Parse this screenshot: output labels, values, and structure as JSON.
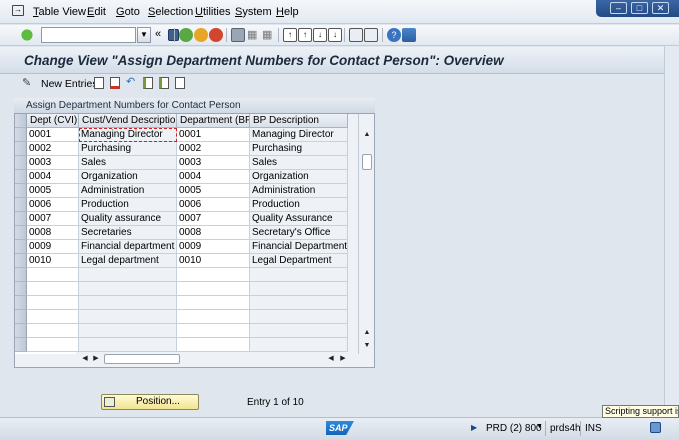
{
  "menu": {
    "items": [
      "Table View",
      "Edit",
      "Goto",
      "Selection",
      "Utilities",
      "System",
      "Help"
    ]
  },
  "toolbar": {
    "command_field_value": "",
    "icons": [
      "enter-icon",
      "save-icon",
      "back-icon",
      "exit-icon",
      "cancel-icon",
      "print-icon",
      "find-icon",
      "find-next-icon",
      "first-page-icon",
      "previous-page-icon",
      "next-page-icon",
      "last-page-icon",
      "create-session-icon",
      "shortcut-icon",
      "help-icon",
      "layout-icon"
    ]
  },
  "title": "Change View \"Assign Department Numbers for Contact Person\": Overview",
  "app_toolbar": {
    "new_entries_label": "New Entries",
    "icons": [
      "display-change-icon",
      "copy-icon",
      "delete-icon",
      "undo-icon",
      "select-all-icon",
      "select-block-icon",
      "deselect-all-icon"
    ]
  },
  "table": {
    "title": "Assign Department Numbers for Contact Person",
    "columns": [
      "Dept (CVI)",
      "Cust/Vend Description",
      "Department (BP)",
      "BP Description"
    ],
    "rows": [
      [
        "0001",
        "Managing Director",
        "0001",
        "Managing Director"
      ],
      [
        "0002",
        "Purchasing",
        "0002",
        "Purchasing"
      ],
      [
        "0003",
        "Sales",
        "0003",
        "Sales"
      ],
      [
        "0004",
        "Organization",
        "0004",
        "Organization"
      ],
      [
        "0005",
        "Administration",
        "0005",
        "Administration"
      ],
      [
        "0006",
        "Production",
        "0006",
        "Production"
      ],
      [
        "0007",
        "Quality assurance",
        "0007",
        "Quality Assurance"
      ],
      [
        "0008",
        "Secretaries",
        "0008",
        "Secretary's Office"
      ],
      [
        "0009",
        "Financial department",
        "0009",
        "Financial Department"
      ],
      [
        "0010",
        "Legal department",
        "0010",
        "Legal Department"
      ]
    ]
  },
  "position_button_label": "Position...",
  "entry_info": "Entry 1 of 10",
  "status": {
    "sap_logo": "SAP",
    "system": "PRD (2) 800",
    "server": "prds4h",
    "mode": "INS",
    "tooltip": "Scripting support is c"
  },
  "colors": {
    "title_text": "#1b2a3c",
    "position_button": "#f2e48f",
    "window_controls": "#2a5290"
  }
}
